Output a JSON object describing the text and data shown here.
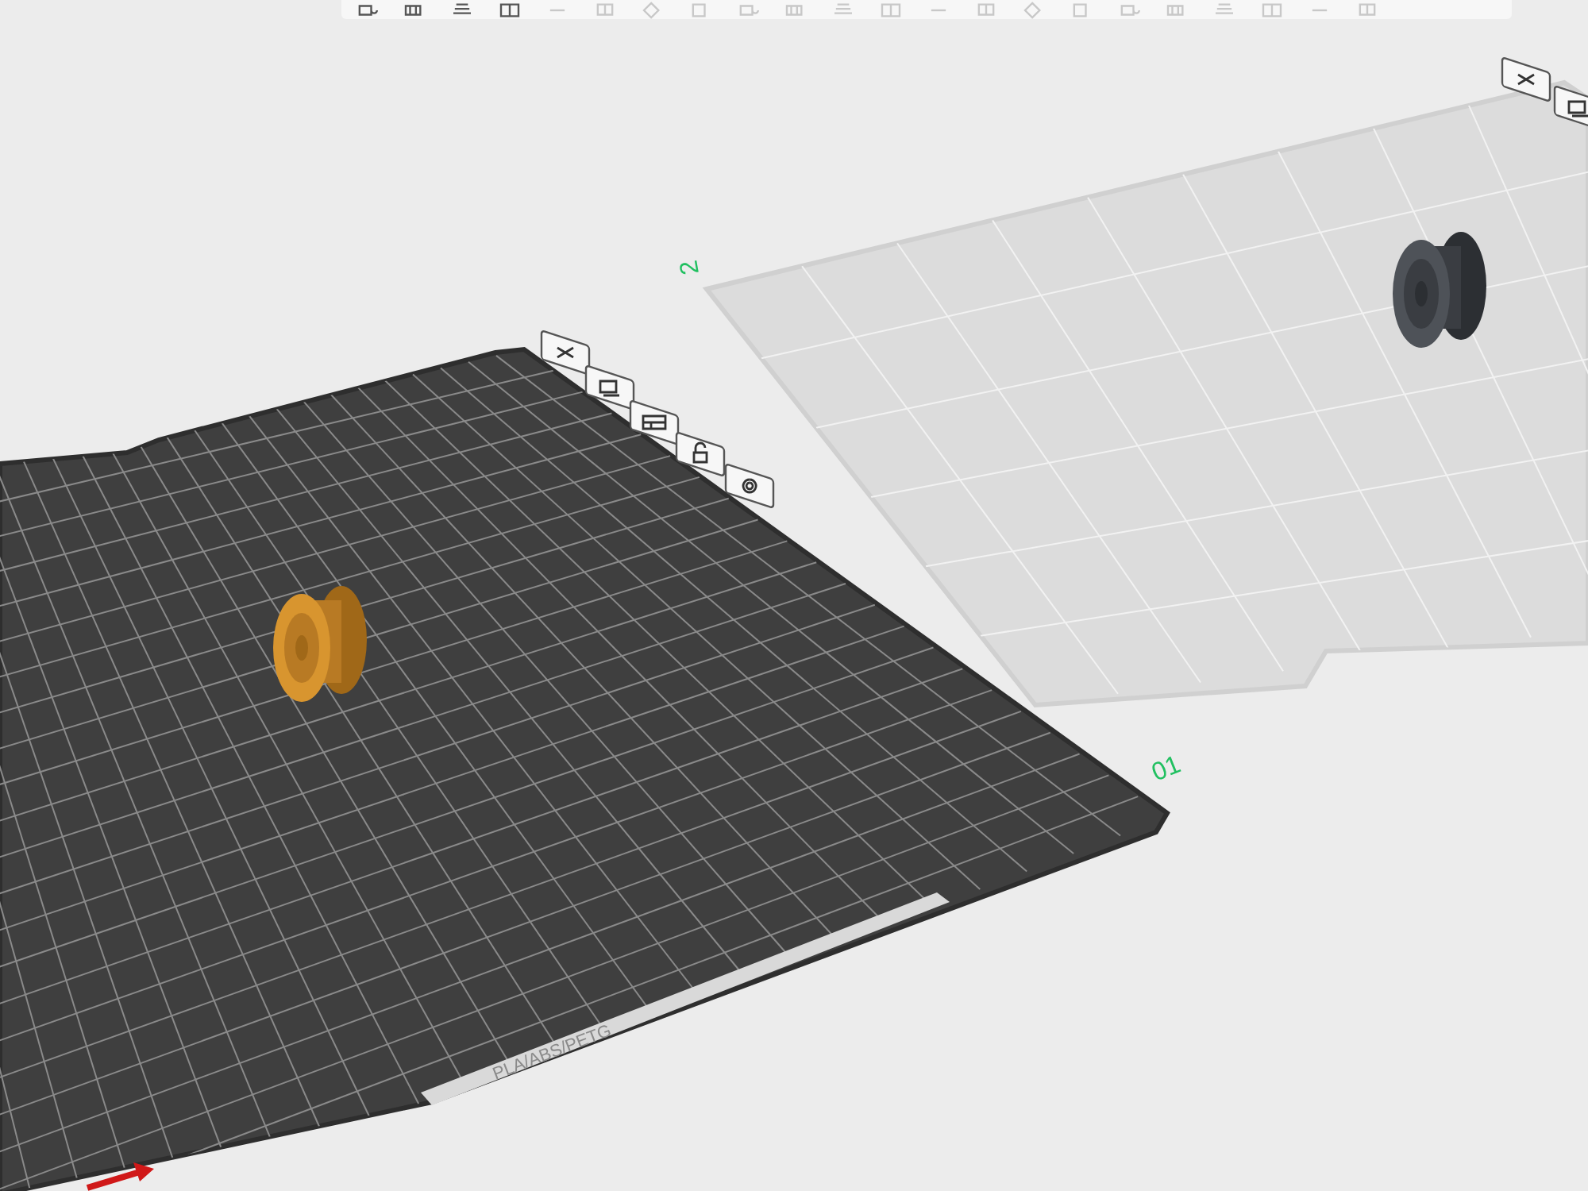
{
  "plates": [
    {
      "label": "2",
      "selected": false
    },
    {
      "label": "01",
      "selected": true,
      "material_label": "PLA/ABS/PETG"
    }
  ]
}
